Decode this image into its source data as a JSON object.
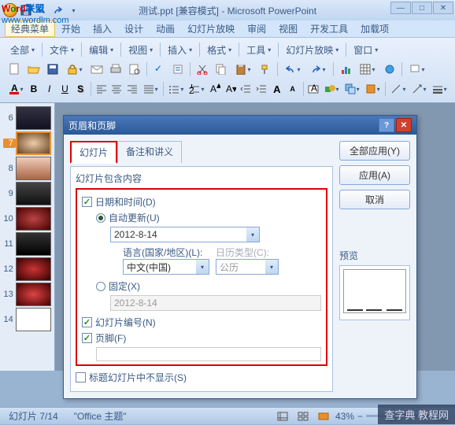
{
  "watermark": {
    "line1_a": "W",
    "line1_b": "o",
    "line1_c": "rd",
    "line1_d": "联盟",
    "line2": "www.wordlm.com"
  },
  "titlebar": {
    "title": "测试.ppt [兼容模式] - Microsoft PowerPoint"
  },
  "menubar": {
    "items": [
      "经典菜单",
      "开始",
      "插入",
      "设计",
      "动画",
      "幻灯片放映",
      "审阅",
      "视图",
      "开发工具",
      "加载项"
    ]
  },
  "toolbar_dropdowns": {
    "row1": [
      "全部",
      "文件",
      "编辑",
      "视图",
      "插入",
      "格式",
      "工具",
      "幻灯片放映",
      "窗口"
    ]
  },
  "thumbs": {
    "start": 6,
    "count": 9,
    "selected": 7
  },
  "dialog": {
    "title": "页眉和页脚",
    "tabs": [
      "幻灯片",
      "备注和讲义"
    ],
    "group": "幻灯片包含内容",
    "datetime": "日期和时间(D)",
    "auto_update": "自动更新(U)",
    "date_value": "2012-8-14",
    "lang_label": "语言(国家/地区)(L):",
    "lang_value": "中文(中国)",
    "cal_label": "日历类型(C):",
    "cal_value": "公历",
    "fixed": "固定(X)",
    "fixed_value": "2012-8-14",
    "slide_num": "幻灯片编号(N)",
    "footer": "页脚(F)",
    "no_title": "标题幻灯片中不显示(S)",
    "apply_all": "全部应用(Y)",
    "apply": "应用(A)",
    "cancel": "取消",
    "preview": "预览"
  },
  "status": {
    "slide": "幻灯片 7/14",
    "theme": "\"Office 主题\"",
    "zoom": "43%"
  },
  "bottom_wm": "查字典  教程网"
}
